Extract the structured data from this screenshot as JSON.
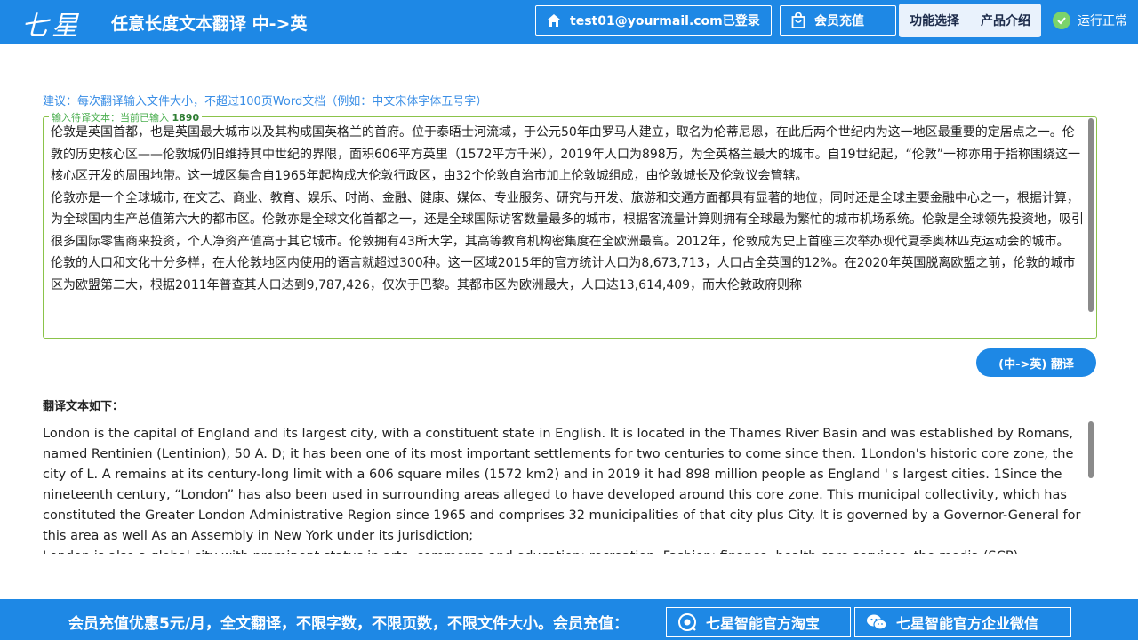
{
  "header": {
    "logo": "七星",
    "title": "任意长度文本翻译 中->英",
    "user_label": "test01@yourmail.com已登录",
    "vip_label": "会员充值",
    "menu": [
      "功能选择",
      "产品介绍"
    ],
    "status": "运行正常"
  },
  "hint": "建议：每次翻译输入文件大小，不超过100页Word文档（例如：中文宋体字体五号字）",
  "input": {
    "legend_prefix": "输入待译文本：当前已输入",
    "char_count": "1890",
    "paragraphs": [
      "伦敦是英国首都，也是英国最大城市以及其构成国英格兰的首府。位于泰晤士河流域，于公元50年由罗马人建立，取名为伦蒂尼恩，在此后两个世纪内为这一地区最重要的定居点之一。伦敦的历史核心区——伦敦城仍旧维持其中世纪的界限，面积606平方英里（1572平方千米），2019年人口为898万，为全英格兰最大的城市。自19世纪起，“伦敦”一称亦用于指称围绕这一核心区开发的周围地带。这一城区集合自1965年起构成大伦敦行政区，由32个伦敦自治市加上伦敦城组成，由伦敦城长及伦敦议会管辖。",
      "伦敦亦是一个全球城市, 在文艺、商业、教育、娱乐、时尚、金融、健康、媒体、专业服务、研究与开发、旅游和交通方面都具有显著的地位，同时还是全球主要金融中心之一，根据计算，为全球国内生产总值第六大的都市区。伦敦亦是全球文化首都之一，还是全球国际访客数量最多的城市，根据客流量计算则拥有全球最为繁忙的城市机场系统。伦敦是全球领先投资地，吸引很多国际零售商来投资，个人净资产值高于其它城市。伦敦拥有43所大学，其高等教育机构密集度在全欧洲最高。2012年，伦敦成为史上首座三次举办现代夏季奥林匹克运动会的城市。",
      "伦敦的人口和文化十分多样，在大伦敦地区内使用的语言就超过300种。这一区域2015年的官方统计人口为8,673,713，人口占全英国的12%。在2020年英国脱离欧盟之前，伦敦的城市区为欧盟第二大，根据2011年普查其人口达到9,787,426，仅次于巴黎。其都市区为欧洲最大，人口达13,614,409，而大伦敦政府则称"
    ]
  },
  "translate_button": "(中->英) 翻译",
  "result": {
    "title": "翻译文本如下：",
    "paragraphs": [
      "London is the capital of England and its largest city, with a constituent state in English. It is located in the Thames River Basin and was established by Romans, named Rentinien (Lentinion), 50 A. D; it has been one of its most important settlements for two centuries to come since then. 1London's historic core zone, the city of L. A remains at its century-long limit with a 606 square miles (1572 km2) and in 2019 it had 898 million people as England ' s largest cities. 1Since the nineteenth century, “London” has also been used in surrounding areas alleged to have developed around this core zone. This municipal collectivity, which has constituted the Greater London Administrative Region since 1965 and comprises 32 municipalities of that city plus City. It is governed by a Governor-General for this area as well As an Assembly in New York under its jurisdiction;",
      "London is also a global city with prominent status in arts, commerce and education; recreation, Fashion; finance, health care services, the media (SCP)"
    ]
  },
  "footer": {
    "promo": "会员充值优惠5元/月，全文翻译，不限字数，不限页数，不限文件大小。会员充值：",
    "taobao": "七星智能官方淘宝",
    "wechat": "七星智能官方企业微信"
  },
  "colors": {
    "primary": "#1e88e5",
    "input_border": "#8bc34a",
    "hint": "#3a8ee6",
    "status_ok": "#7bd36b"
  },
  "icons": [
    "home-icon",
    "shopping-bag-icon",
    "check-circle-icon",
    "taobao-icon",
    "wechat-icon"
  ]
}
